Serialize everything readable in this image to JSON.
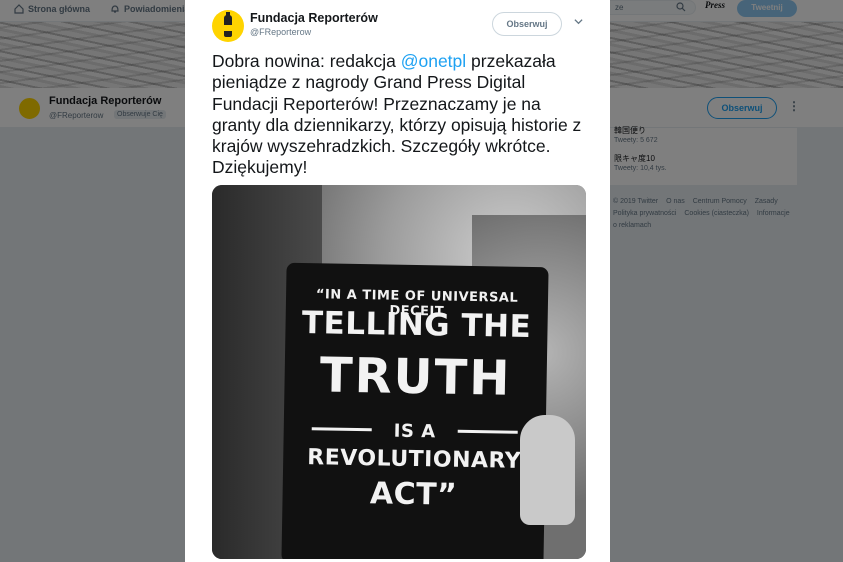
{
  "topnav": {
    "home_label": "Strona główna",
    "notifications_label": "Powiadomienia",
    "search_placeholder": "ze",
    "press_logo": "Press",
    "tweet_button": "Tweetnij"
  },
  "profile": {
    "name": "Fundacja Reporterów",
    "handle": "@FReporterow",
    "follows_you": "Obserwuje Cię",
    "follow_button": "Obserwuj"
  },
  "trends": [
    {
      "name": "韓国便り",
      "count": "Tweety: 5 672"
    },
    {
      "name": "限キャ度10",
      "count": "Tweety: 10,4 tys."
    }
  ],
  "footer": [
    "© 2019 Twitter",
    "O nas",
    "Centrum Pomocy",
    "Zasady",
    "Polityka prywatności",
    "Cookies (ciasteczka)",
    "Informacje o reklamach"
  ],
  "tweet": {
    "name": "Fundacja Reporterów",
    "handle": "@FReporterow",
    "follow_button": "Obserwuj",
    "text_before": "Dobra nowina: redakcja ",
    "mention": "@onetpl",
    "text_after": " przekazała pieniądze z nagrody Grand Press Digital Fundacji Reporterów! Przeznaczamy je na granty dla dziennikarzy, którzy opisują historie z krajów wyszehradzkich. Szczegóły wkrótce. Dziękujemy!",
    "image_text": {
      "line1": "“IN A TIME OF UNIVERSAL DECEIT",
      "line2": "TELLING THE",
      "line3": "TRUTH",
      "line4": "IS A",
      "line5": "REVOLUTIONARY",
      "line6": "ACT”"
    }
  },
  "colors": {
    "accent": "#1da1f2",
    "brand_yellow": "#ffd400"
  }
}
